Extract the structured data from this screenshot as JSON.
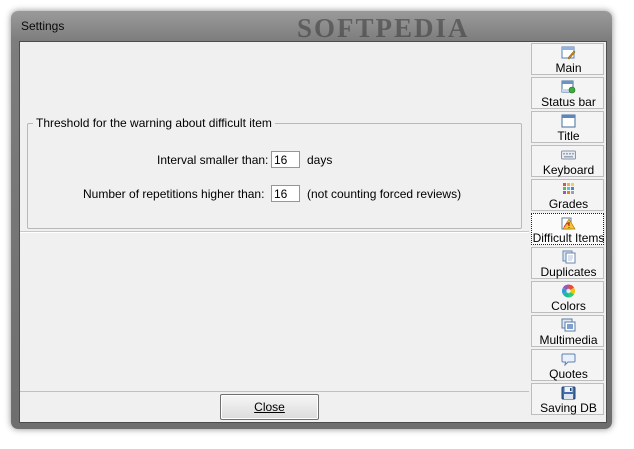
{
  "window": {
    "title": "Settings",
    "watermark": "SOFTPEDIA"
  },
  "group": {
    "title": "Threshold for the warning about difficult item",
    "interval_label": "Interval smaller than:",
    "interval_value": "16",
    "interval_unit": "days",
    "repetitions_label": "Number of repetitions higher than:",
    "repetitions_value": "16",
    "repetitions_note": "(not counting forced reviews)"
  },
  "footer": {
    "close_label": "Close"
  },
  "sidebar": {
    "items": [
      {
        "label": "Main",
        "icon": "main-icon"
      },
      {
        "label": "Status bar",
        "icon": "status-bar-icon"
      },
      {
        "label": "Title",
        "icon": "title-icon"
      },
      {
        "label": "Keyboard",
        "icon": "keyboard-icon"
      },
      {
        "label": "Grades",
        "icon": "grades-icon"
      },
      {
        "label": "Difficult Items",
        "icon": "difficult-items-icon",
        "selected": true
      },
      {
        "label": "Duplicates",
        "icon": "duplicates-icon"
      },
      {
        "label": "Colors",
        "icon": "colors-icon"
      },
      {
        "label": "Multimedia",
        "icon": "multimedia-icon"
      },
      {
        "label": "Quotes",
        "icon": "quotes-icon"
      },
      {
        "label": "Saving DB",
        "icon": "saving-db-icon"
      }
    ]
  }
}
